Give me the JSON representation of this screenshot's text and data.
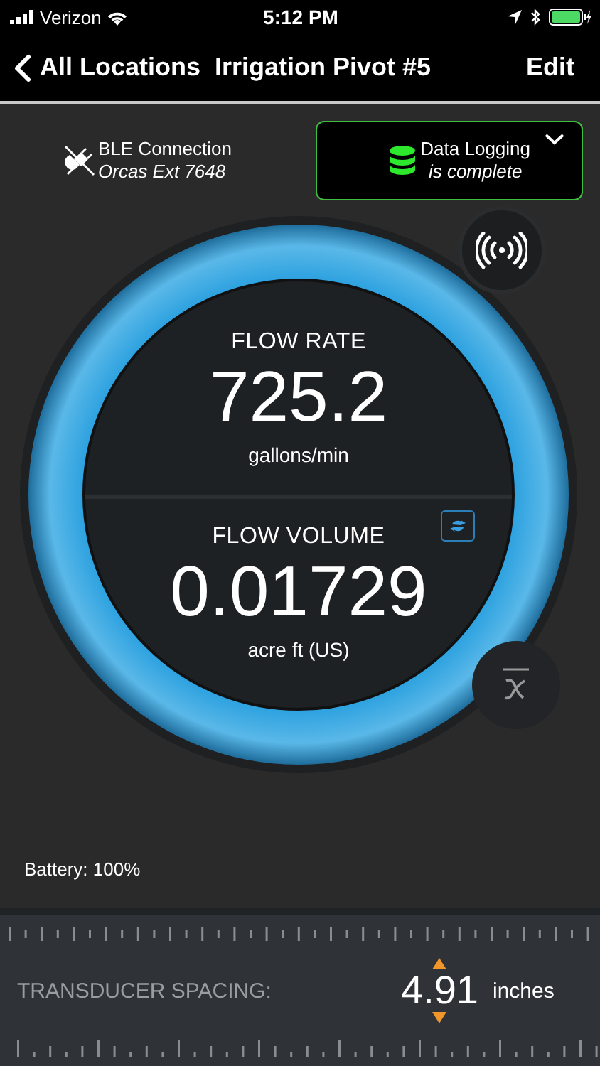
{
  "status_bar": {
    "carrier": "Verizon",
    "time": "5:12 PM"
  },
  "nav": {
    "back": "All Locations",
    "title": "Irrigation Pivot #5",
    "action": "Edit"
  },
  "connection": {
    "label": "BLE Connection",
    "device": "Orcas Ext 7648"
  },
  "logging": {
    "title": "Data Logging",
    "status": "is complete"
  },
  "readings": [
    {
      "label": "FLOW RATE",
      "value": "725.2",
      "unit": "gallons/min"
    },
    {
      "label": "FLOW VOLUME",
      "value": "0.01729",
      "unit": "acre ft (US)"
    }
  ],
  "battery": "Battery:  100%",
  "transducer": {
    "label": "TRANSDUCER SPACING:",
    "value": "4.91",
    "unit": "inches"
  }
}
